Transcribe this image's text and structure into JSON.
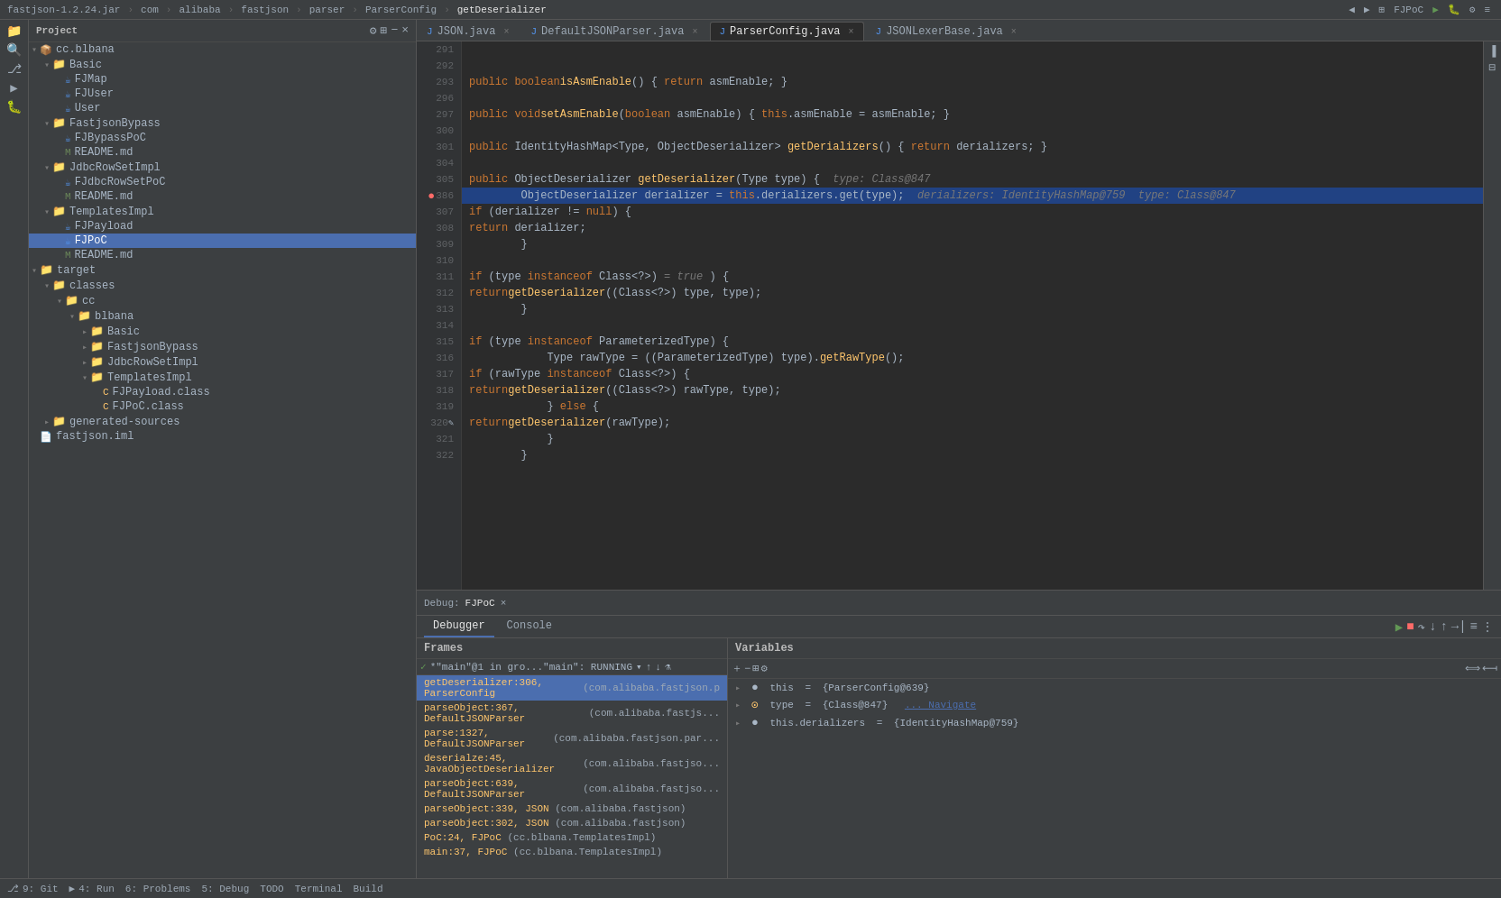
{
  "app": {
    "title": "fastjson-1.2.24.jar",
    "breadcrumb": [
      "fastjson-1.2.24.jar",
      "com",
      "alibaba",
      "fastjson",
      "parser",
      "ParserConfig",
      "getDeserializer"
    ]
  },
  "tabs": [
    {
      "id": "json-java",
      "label": "JSON.java",
      "icon": "J",
      "active": false
    },
    {
      "id": "default-json-parser",
      "label": "DefaultJSONParser.java",
      "icon": "J",
      "active": false
    },
    {
      "id": "parser-config",
      "label": "ParserConfig.java",
      "icon": "J",
      "active": true
    },
    {
      "id": "json-lexer-base",
      "label": "JSONLexerBase.java",
      "icon": "J",
      "active": false
    }
  ],
  "code": {
    "lines": [
      {
        "num": "291",
        "content": "",
        "tokens": []
      },
      {
        "num": "292",
        "content": "",
        "tokens": []
      },
      {
        "num": "293",
        "content": "    public boolean isAsmEnable() { return asmEnable; }",
        "highlighted": false
      },
      {
        "num": "296",
        "content": "",
        "tokens": []
      },
      {
        "num": "297",
        "content": "    public void setAsmEnable(boolean asmEnable) { this.asmEnable = asmEnable; }",
        "highlighted": false
      },
      {
        "num": "300",
        "content": "",
        "tokens": []
      },
      {
        "num": "301",
        "content": "    public IdentityHashMap<Type, ObjectDeserializer> getDerializers() { return derializers; }",
        "highlighted": false
      },
      {
        "num": "304",
        "content": "",
        "tokens": []
      },
      {
        "num": "305",
        "content": "    public ObjectDeserializer getDeserializer(Type type) {  // type: Class@847",
        "highlighted": false,
        "has_hint": true,
        "hint": "type: Class@847"
      },
      {
        "num": "386",
        "content": "        ObjectDeserializer derializer = this.derializers.get(type);  derializers: IdentityHashMap@759  type: Class@847",
        "highlighted": true,
        "is_active": true
      },
      {
        "num": "307",
        "content": "        if (derializer != null) {",
        "highlighted": false
      },
      {
        "num": "308",
        "content": "            return derializer;",
        "highlighted": false
      },
      {
        "num": "309",
        "content": "        }",
        "highlighted": false
      },
      {
        "num": "310",
        "content": "",
        "tokens": []
      },
      {
        "num": "311",
        "content": "        if (type instanceof Class<?>) = true  ) {",
        "highlighted": false
      },
      {
        "num": "312",
        "content": "            return getDeserializer((Class<?>) type, type);",
        "highlighted": false
      },
      {
        "num": "313",
        "content": "        }",
        "highlighted": false
      },
      {
        "num": "314",
        "content": "",
        "tokens": []
      },
      {
        "num": "315",
        "content": "        if (type instanceof ParameterizedType) {",
        "highlighted": false
      },
      {
        "num": "316",
        "content": "            Type rawType = ((ParameterizedType) type).getRawType();",
        "highlighted": false
      },
      {
        "num": "317",
        "content": "            if (rawType instanceof Class<?>) {",
        "highlighted": false
      },
      {
        "num": "318",
        "content": "                return getDeserializer((Class<?>) rawType, type);",
        "highlighted": false
      },
      {
        "num": "319",
        "content": "            } else {",
        "highlighted": false
      },
      {
        "num": "320",
        "content": "                return getDeserializer(rawType);",
        "highlighted": false
      },
      {
        "num": "321",
        "content": "            }",
        "highlighted": false
      },
      {
        "num": "322",
        "content": "        }",
        "highlighted": false
      }
    ]
  },
  "sidebar": {
    "title": "Project",
    "tree": [
      {
        "id": "cc-blbana",
        "label": "cc.blbana",
        "type": "package",
        "indent": 1,
        "expanded": true
      },
      {
        "id": "basic",
        "label": "Basic",
        "type": "folder",
        "indent": 2,
        "expanded": true
      },
      {
        "id": "fjmap",
        "label": "FJMap",
        "type": "java",
        "indent": 3
      },
      {
        "id": "fjuser",
        "label": "FJUser",
        "type": "java",
        "indent": 3
      },
      {
        "id": "user",
        "label": "User",
        "type": "java",
        "indent": 3
      },
      {
        "id": "fastjsonbypass",
        "label": "FastjsonBypass",
        "type": "folder",
        "indent": 2,
        "expanded": true
      },
      {
        "id": "fjbypasspoc",
        "label": "FJBypassPoC",
        "type": "java",
        "indent": 3
      },
      {
        "id": "readme1",
        "label": "README.md",
        "type": "md",
        "indent": 3
      },
      {
        "id": "jdbcrowsetimpl",
        "label": "JdbcRowSetImpl",
        "type": "folder",
        "indent": 2,
        "expanded": true
      },
      {
        "id": "fjdbcrowsetpoc",
        "label": "FJdbcRowSetPoC",
        "type": "java",
        "indent": 3
      },
      {
        "id": "readme2",
        "label": "README.md",
        "type": "md",
        "indent": 3
      },
      {
        "id": "templatesimpl",
        "label": "TemplatesImpl",
        "type": "folder",
        "indent": 2,
        "expanded": true
      },
      {
        "id": "fjpayload",
        "label": "FJPayload",
        "type": "java",
        "indent": 3
      },
      {
        "id": "fjpoc",
        "label": "FJPoC",
        "type": "java",
        "indent": 3,
        "selected": true
      },
      {
        "id": "readme3",
        "label": "README.md",
        "type": "md",
        "indent": 3
      },
      {
        "id": "target",
        "label": "target",
        "type": "folder-red",
        "indent": 1,
        "expanded": true
      },
      {
        "id": "classes",
        "label": "classes",
        "type": "folder",
        "indent": 2,
        "expanded": true
      },
      {
        "id": "cc-pkg",
        "label": "cc",
        "type": "folder",
        "indent": 3,
        "expanded": true
      },
      {
        "id": "blbana-pkg",
        "label": "blbana",
        "type": "folder",
        "indent": 4,
        "expanded": true
      },
      {
        "id": "basic-pkg",
        "label": "Basic",
        "type": "folder",
        "indent": 5,
        "expanded": false
      },
      {
        "id": "fastjson-pkg",
        "label": "FastjsonBypass",
        "type": "folder",
        "indent": 5,
        "expanded": false
      },
      {
        "id": "jdbc-pkg",
        "label": "JdbcRowSetImpl",
        "type": "folder",
        "indent": 5,
        "expanded": false
      },
      {
        "id": "templates-pkg",
        "label": "TemplatesImpl",
        "type": "folder",
        "indent": 5,
        "expanded": true
      },
      {
        "id": "fjpayload-class",
        "label": "FJPayload.class",
        "type": "class",
        "indent": 6
      },
      {
        "id": "fjpoc-class",
        "label": "FJPoC.class",
        "type": "class",
        "indent": 6
      },
      {
        "id": "generated-sources",
        "label": "generated-sources",
        "type": "folder",
        "indent": 2,
        "expanded": false
      },
      {
        "id": "fastjson-impl",
        "label": "fastjson.iml",
        "type": "iml",
        "indent": 1
      }
    ]
  },
  "debug": {
    "bar_label": "Debug: FJPoC",
    "close": "×",
    "tabs": [
      "Debugger",
      "Console"
    ],
    "active_tab": "Debugger"
  },
  "frames": {
    "header": "Frames",
    "thread": "*\"main\"@1 in gro...\"main\": RUNNING",
    "items": [
      {
        "id": "f1",
        "method": "getDeserializer:306",
        "class": "ParserConfig",
        "pkg": "(com.alibaba.fastjson.p",
        "selected": true
      },
      {
        "id": "f2",
        "method": "parseObject:367",
        "class": "DefaultJSONParser",
        "pkg": "(com.alibaba.fastjs...",
        "selected": false
      },
      {
        "id": "f3",
        "method": "parse:1327",
        "class": "DefaultJSONParser",
        "pkg": "(com.alibaba.fastjson.par...",
        "selected": false
      },
      {
        "id": "f4",
        "method": "deserialze:45",
        "class": "JavaObjectDeserializer",
        "pkg": "(com.alibaba.fastjso...",
        "selected": false
      },
      {
        "id": "f5",
        "method": "parseObject:639",
        "class": "DefaultJSONParser",
        "pkg": "(com.alibaba.fastjso...",
        "selected": false
      },
      {
        "id": "f6",
        "method": "parseObject:339",
        "class": "JSON",
        "pkg": "(com.alibaba.fastjson)",
        "selected": false
      },
      {
        "id": "f7",
        "method": "parseObject:302",
        "class": "JSON",
        "pkg": "(com.alibaba.fastjson)",
        "selected": false
      },
      {
        "id": "f8",
        "method": "PoC:24",
        "class": "FJPoC",
        "pkg": "(cc.blbana.TemplatesImpl)",
        "selected": false
      },
      {
        "id": "f9",
        "method": "main:37",
        "class": "FJPoC",
        "pkg": "(cc.blbana.TemplatesImpl)",
        "selected": false
      }
    ]
  },
  "variables": {
    "header": "Variables",
    "items": [
      {
        "id": "v1",
        "name": "this",
        "value": "{ParserConfig@639}",
        "expanded": false,
        "icon": "obj"
      },
      {
        "id": "v2",
        "name": "type",
        "value": "{Class@847}",
        "extra": "... Navigate",
        "expanded": false,
        "icon": "type"
      },
      {
        "id": "v3",
        "name": "this.derializers",
        "value": "{IdentityHashMap@759}",
        "expanded": false,
        "icon": "obj"
      }
    ]
  },
  "status_bar": {
    "git": "9: Git",
    "run": "4: Run",
    "problems": "6: Problems",
    "debug": "5: Debug",
    "todo": "TODO",
    "terminal": "Terminal",
    "build": "Build"
  }
}
